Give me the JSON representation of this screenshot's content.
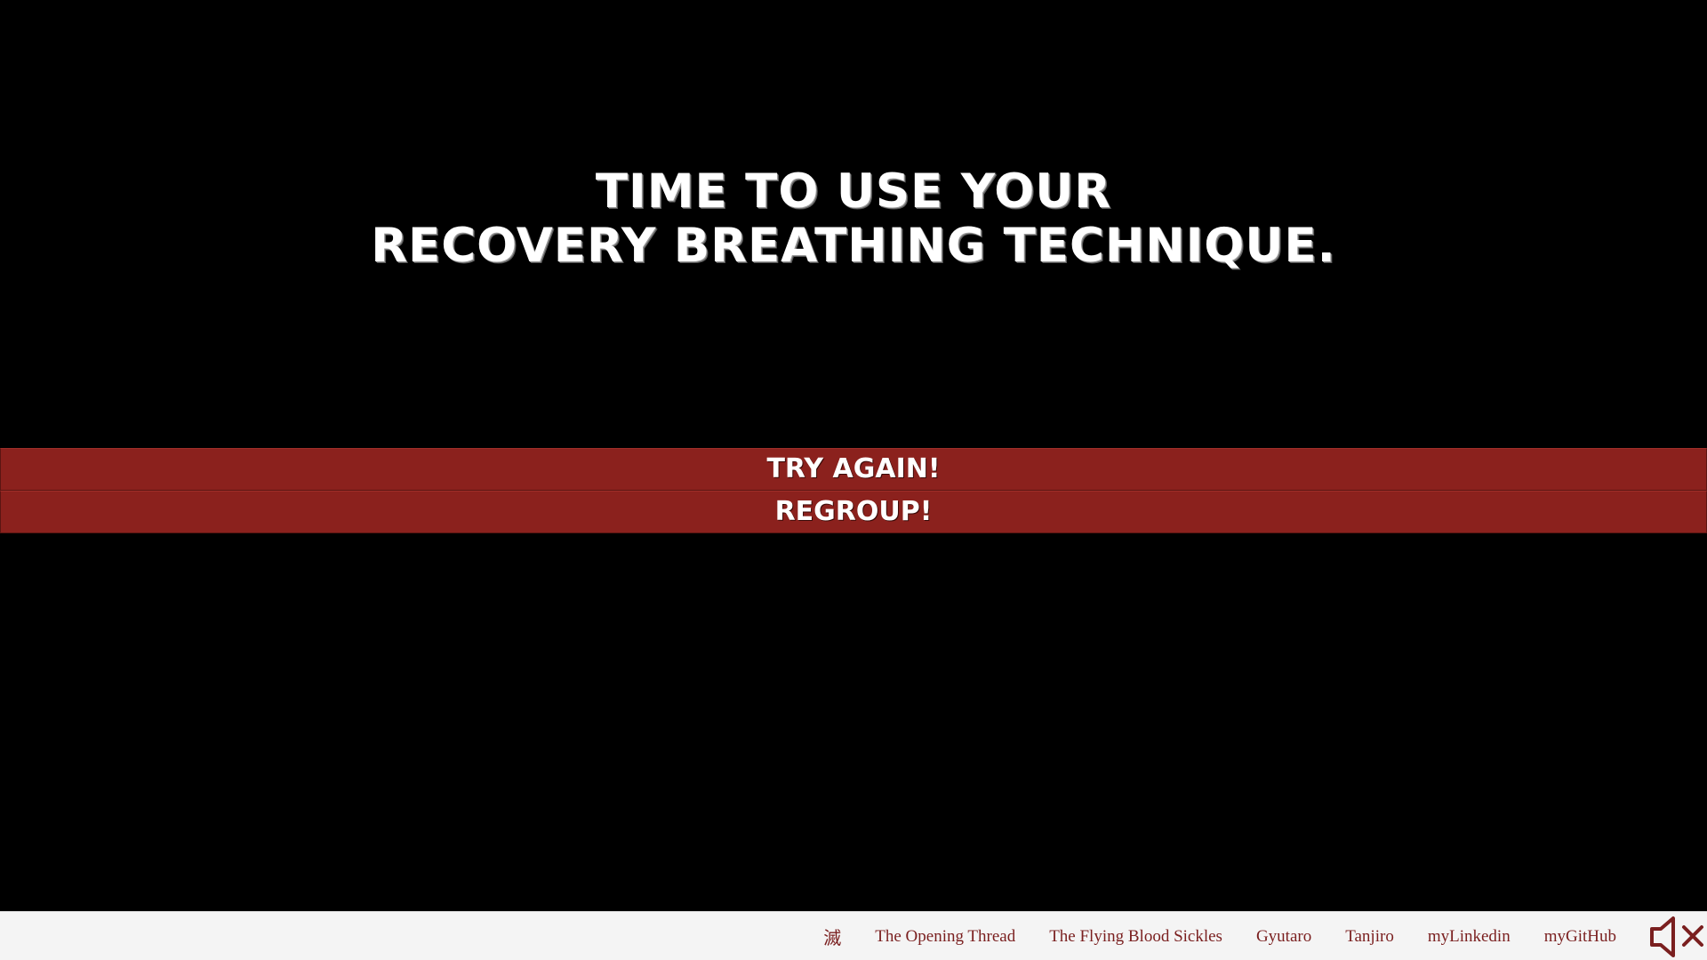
{
  "headline": {
    "line1": "TIME TO USE YOUR",
    "line2": "RECOVERY BREATHING TECHNIQUE."
  },
  "choices": {
    "try_again": "TRY AGAIN!",
    "regroup": "REGROUP!"
  },
  "footer": {
    "nav": [
      {
        "label": "滅"
      },
      {
        "label": "The Opening Thread"
      },
      {
        "label": "The Flying Blood Sickles"
      },
      {
        "label": "Gyutaro"
      },
      {
        "label": "Tanjiro"
      },
      {
        "label": "myLinkedin"
      },
      {
        "label": "myGitHub"
      }
    ],
    "mute_icon": "speaker-muted-icon"
  },
  "colors": {
    "background": "#000000",
    "button": "#8b211d",
    "link": "#7a1f1f",
    "footer": "#f4f4f4"
  }
}
